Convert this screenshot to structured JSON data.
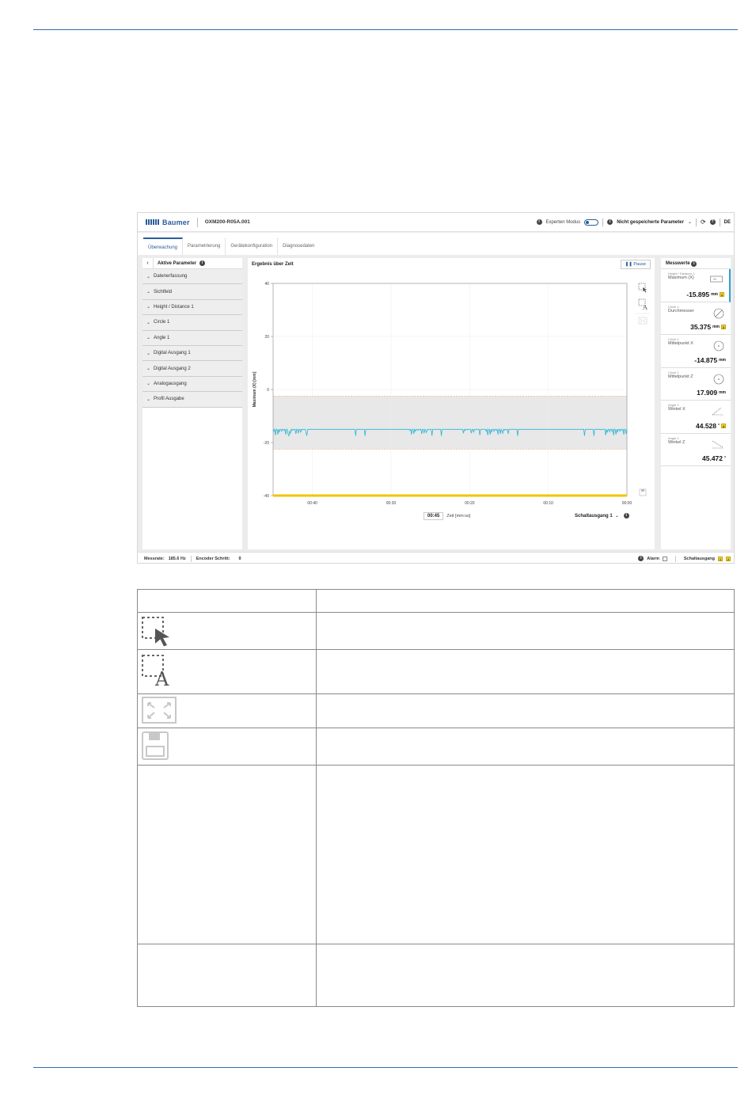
{
  "topbar": {
    "brand": "Baumer",
    "device": "OXM200-R05A.001",
    "expert_mode": "Experten Modus",
    "toggle_state": "AUS",
    "unsaved": "Nicht gespeicherte Parameter",
    "language": "DE"
  },
  "tabs": [
    "Überwachung",
    "Parametrierung",
    "Gerätekonfiguration",
    "Diagnosedaten"
  ],
  "left_panel": {
    "title": "Aktive Parameter",
    "items": [
      "Datenerfassung",
      "Sichtfeld",
      "Height / Distance 1",
      "Circle 1",
      "Angle 1",
      "Digital Ausgang 1",
      "Digital Ausgang 2",
      "Analogausgang",
      "Profil Ausgabe"
    ]
  },
  "chart_panel": {
    "title": "Ergebnis über Zeit",
    "pause": "Pause",
    "time_value": "00:45",
    "time_unit": "Zeit [mm:ss]",
    "output_select": "Schaltausgang 1"
  },
  "chart_data": {
    "type": "line",
    "ylabel": "Maximum (X) [mm]",
    "ylim": [
      -40,
      40
    ],
    "yticks": [
      "40",
      "20",
      "0",
      "-20",
      "-40"
    ],
    "xticks": [
      "00:40",
      "00:30",
      "00:20",
      "00:10",
      "00:00"
    ],
    "xlim": [
      45,
      0
    ],
    "tolerance_band": [
      -22.5,
      -2.5
    ],
    "baseline_value": -15.0,
    "dip_min": -17.5,
    "series_color": "#29b6d6",
    "band_color": "#e8e8e8",
    "limit_color": "#f0a050",
    "output_bar_color": "#f2c500"
  },
  "measurements": {
    "title": "Messwerte",
    "items": [
      {
        "caption": "Height / Distance 1",
        "name": "Maximum (X)",
        "value": "-15.895",
        "unit": "mm",
        "badge": "1"
      },
      {
        "caption": "Circle 1",
        "name": "Durchmesser",
        "value": "35.375",
        "unit": "mm",
        "badge": "2"
      },
      {
        "caption": "Circle 1",
        "name": "Mittelpunkt X",
        "value": "-14.875",
        "unit": "mm",
        "badge": ""
      },
      {
        "caption": "Circle 1",
        "name": "Mittelpunkt Z",
        "value": "17.909",
        "unit": "mm",
        "badge": ""
      },
      {
        "caption": "Angle 1",
        "name": "Winkel X",
        "value": "44.528",
        "unit": "°",
        "badge": "4"
      },
      {
        "caption": "Angle 1",
        "name": "Winkel Z",
        "value": "45.472",
        "unit": "°",
        "badge": ""
      }
    ]
  },
  "statusbar": {
    "rate_label": "Messrate:",
    "rate_value": "185.6 Hz",
    "encoder_label": "Encoder Schritt:",
    "encoder_value": "0",
    "alarm": "Alarm",
    "output": "Schaltausgang",
    "out1": "1",
    "out2": "2"
  }
}
